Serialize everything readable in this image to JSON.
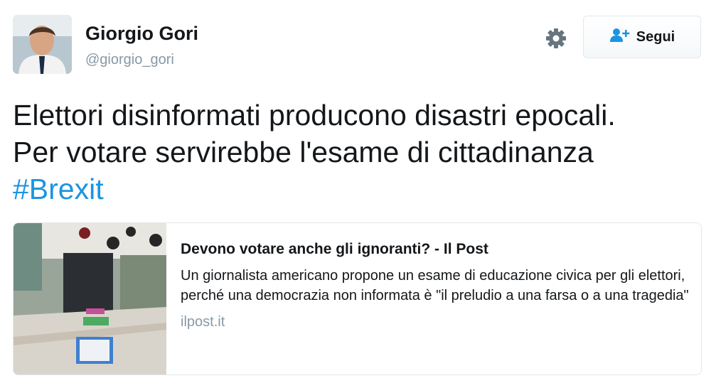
{
  "user": {
    "name": "Giorgio Gori",
    "handle": "@giorgio_gori"
  },
  "actions": {
    "follow_label": "Segui",
    "settings_icon": "gear-icon",
    "follow_icon": "add-user-icon"
  },
  "tweet": {
    "lines": [
      "Elettori disinformati producono disastri epocali.",
      "Per votare servirebbe l'esame di cittadinanza"
    ],
    "hashtag": "#Brexit"
  },
  "card": {
    "title": "Devono votare anche gli ignoranti? - Il Post",
    "description": "Un giornalista americano propone un esame di educazione civica per gli elettori, perché una democrazia non informata è \"il preludio a una farsa o a una tragedia\"",
    "domain": "ilpost.it"
  },
  "colors": {
    "link": "#1b95e0",
    "secondary_text": "#8899a6",
    "follow_icon": "#1b95e0"
  }
}
